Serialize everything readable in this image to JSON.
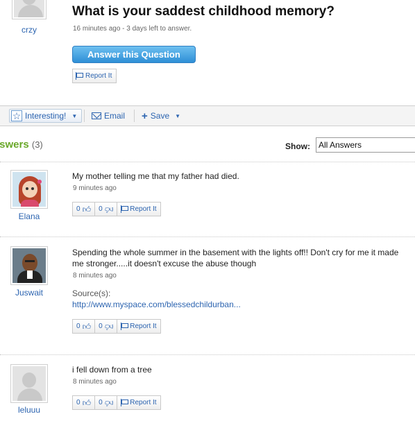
{
  "question": {
    "asker": "crzy",
    "title": "What is your saddest childhood memory?",
    "meta": "16 minutes ago - 3 days left to answer.",
    "answer_button": "Answer this Question",
    "report_label": "Report It"
  },
  "actions": {
    "interesting": "Interesting!",
    "email": "Email",
    "save": "Save"
  },
  "answers_header": {
    "title": "nswers",
    "count": "(3)",
    "show_label": "Show:",
    "show_selected": "All Answers"
  },
  "answers": [
    {
      "user": "Elana",
      "text": "My mother telling me that my father had died.",
      "time": "9 minutes ago",
      "up": "0",
      "down": "0",
      "report": "Report It"
    },
    {
      "user": "Juswait",
      "text": "Spending the whole summer in the basement with the lights off!! Don't cry for me it made me stronger.....it doesn't excuse the abuse though",
      "time": "8 minutes ago",
      "source_label": "Source(s):",
      "source_link": "http://www.myspace.com/blessedchildurban...",
      "up": "0",
      "down": "0",
      "report": "Report It"
    },
    {
      "user": "leluuu",
      "text": "i fell down from a tree",
      "time": "8 minutes ago",
      "up": "0",
      "down": "0",
      "report": "Report It"
    }
  ]
}
